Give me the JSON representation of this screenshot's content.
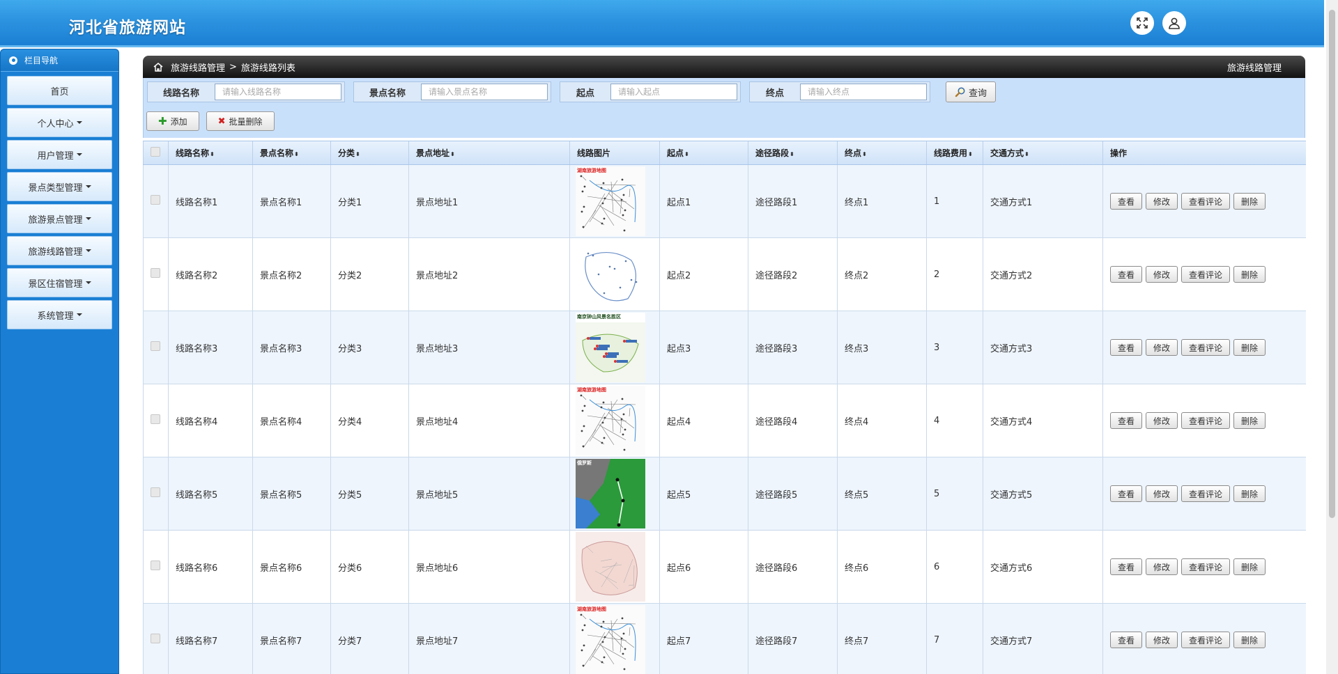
{
  "header": {
    "title": "河北省旅游网站",
    "icons": [
      "fullscreen-icon",
      "user-icon"
    ]
  },
  "sidebar": {
    "title": "栏目导航",
    "items": [
      {
        "label": "首页",
        "dropdown": false
      },
      {
        "label": "个人中心",
        "dropdown": true
      },
      {
        "label": "用户管理",
        "dropdown": true
      },
      {
        "label": "景点类型管理",
        "dropdown": true
      },
      {
        "label": "旅游景点管理",
        "dropdown": true
      },
      {
        "label": "旅游线路管理",
        "dropdown": true
      },
      {
        "label": "景区住宿管理",
        "dropdown": true
      },
      {
        "label": "系统管理",
        "dropdown": true
      }
    ]
  },
  "breadcrumb": {
    "parent": "旅游线路管理",
    "separator": ">",
    "current": "旅游线路列表",
    "right_title": "旅游线路管理"
  },
  "filters": [
    {
      "label": "线路名称",
      "placeholder": "请输入线路名称"
    },
    {
      "label": "景点名称",
      "placeholder": "请输入景点名称"
    },
    {
      "label": "起点",
      "placeholder": "请输入起点"
    },
    {
      "label": "终点",
      "placeholder": "请输入终点"
    }
  ],
  "search_button": "查询",
  "actions": {
    "add": "添加",
    "batch_delete": "批量删除"
  },
  "table": {
    "columns": [
      "线路名称",
      "景点名称",
      "分类",
      "景点地址",
      "线路图片",
      "起点",
      "途径路段",
      "终点",
      "线路费用",
      "交通方式",
      "操作"
    ],
    "row_buttons": [
      "查看",
      "修改",
      "查看评论",
      "删除"
    ],
    "rows": [
      {
        "route": "线路名称1",
        "spot": "景点名称1",
        "category": "分类1",
        "address": "景点地址1",
        "start": "起点1",
        "via": "途径路段1",
        "end": "终点1",
        "cost": "1",
        "transport": "交通方式1",
        "img_caption": "湖南旅游地图"
      },
      {
        "route": "线路名称2",
        "spot": "景点名称2",
        "category": "分类2",
        "address": "景点地址2",
        "start": "起点2",
        "via": "途径路段2",
        "end": "终点2",
        "cost": "2",
        "transport": "交通方式2",
        "img_caption": ""
      },
      {
        "route": "线路名称3",
        "spot": "景点名称3",
        "category": "分类3",
        "address": "景点地址3",
        "start": "起点3",
        "via": "途径路段3",
        "end": "终点3",
        "cost": "3",
        "transport": "交通方式3",
        "img_caption": "南京钟山风景名胜区"
      },
      {
        "route": "线路名称4",
        "spot": "景点名称4",
        "category": "分类4",
        "address": "景点地址4",
        "start": "起点4",
        "via": "途径路段4",
        "end": "终点4",
        "cost": "4",
        "transport": "交通方式4",
        "img_caption": "湖南旅游地图"
      },
      {
        "route": "线路名称5",
        "spot": "景点名称5",
        "category": "分类5",
        "address": "景点地址5",
        "start": "起点5",
        "via": "途径路段5",
        "end": "终点5",
        "cost": "5",
        "transport": "交通方式5",
        "img_caption": "俄罗斯"
      },
      {
        "route": "线路名称6",
        "spot": "景点名称6",
        "category": "分类6",
        "address": "景点地址6",
        "start": "起点6",
        "via": "途径路段6",
        "end": "终点6",
        "cost": "6",
        "transport": "交通方式6",
        "img_caption": ""
      },
      {
        "route": "线路名称7",
        "spot": "景点名称7",
        "category": "分类7",
        "address": "景点地址7",
        "start": "起点7",
        "via": "途径路段7",
        "end": "终点7",
        "cost": "7",
        "transport": "交通方式7",
        "img_caption": "湖南旅游地图"
      }
    ]
  }
}
